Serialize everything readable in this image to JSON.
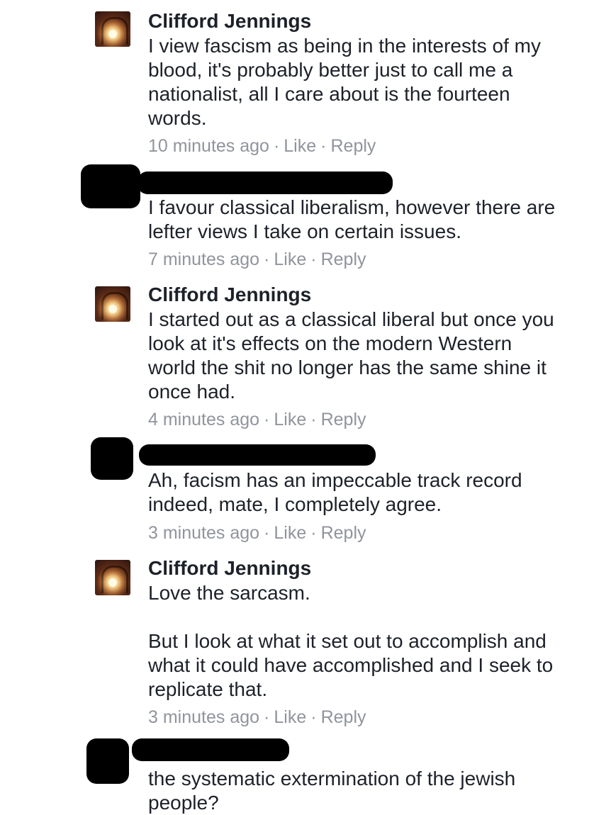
{
  "comments": [
    {
      "name": "Clifford Jennings",
      "lines": [
        "I view fascism as being in the interests of my",
        "blood, it's probably better just to call me a",
        "nationalist, all I care about is the fourteen",
        "words."
      ],
      "time": "10 minutes ago",
      "dot1": "·",
      "like": "Like",
      "dot2": "·",
      "reply": "Reply"
    },
    {
      "name": "",
      "lines": [
        "I favour classical liberalism, however there are",
        "lefter views I take on certain issues."
      ],
      "time": "7 minutes ago",
      "dot1": "·",
      "like": "Like",
      "dot2": "·",
      "reply": "Reply"
    },
    {
      "name": "Clifford Jennings",
      "lines": [
        "I started out as a classical liberal but once you",
        "look at it's effects on the modern Western",
        "world the shit no longer has the same shine it",
        "once had."
      ],
      "time": "4 minutes ago",
      "dot1": "·",
      "like": "Like",
      "dot2": "·",
      "reply": "Reply"
    },
    {
      "name": "",
      "lines": [
        "Ah, facism has an impeccable track record",
        "indeed, mate, I completely agree."
      ],
      "time": "3 minutes ago",
      "dot1": "·",
      "like": "Like",
      "dot2": "·",
      "reply": "Reply"
    },
    {
      "name": "Clifford Jennings",
      "lines": [
        "Love the sarcasm.",
        "",
        "But I look at what it set out to accomplish and",
        "what it could have accomplished and I seek to",
        "replicate that."
      ],
      "time": "3 minutes ago",
      "dot1": "·",
      "like": "Like",
      "dot2": "·",
      "reply": "Reply"
    },
    {
      "name": "",
      "lines": [
        "the systematic extermination of the jewish",
        "people?"
      ]
    }
  ]
}
